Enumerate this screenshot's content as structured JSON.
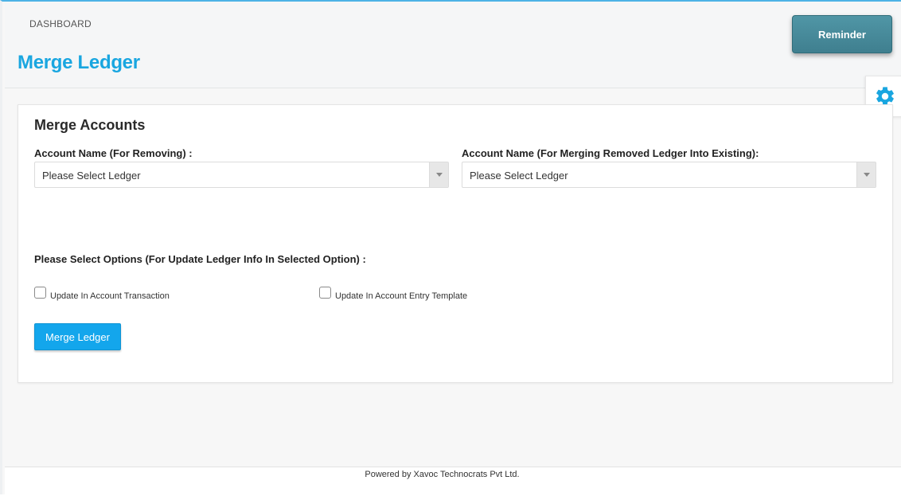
{
  "header": {
    "breadcrumb": "DASHBOARD",
    "title": "Merge Ledger",
    "reminder_label": "Reminder",
    "settings_icon": "gear-icon"
  },
  "form": {
    "section_title": "Merge Accounts",
    "remove_account": {
      "label": "Account Name (For Removing) :",
      "value": "Please Select Ledger"
    },
    "merge_into_account": {
      "label": "Account Name (For Merging Removed Ledger Into Existing):",
      "value": "Please Select Ledger"
    },
    "options_label": "Please Select Options (For Update Ledger Info In Selected Option) :",
    "options": [
      {
        "label": "Update In Account Transaction",
        "checked": false
      },
      {
        "label": "Update In Account Entry Template",
        "checked": false
      }
    ],
    "submit_label": "Merge Ledger"
  },
  "footer": {
    "text": "Powered by Xavoc Technocrats Pvt Ltd."
  },
  "colors": {
    "accent": "#19a6e0",
    "button": "#13a6ec",
    "reminder": "#4a8d9d"
  }
}
